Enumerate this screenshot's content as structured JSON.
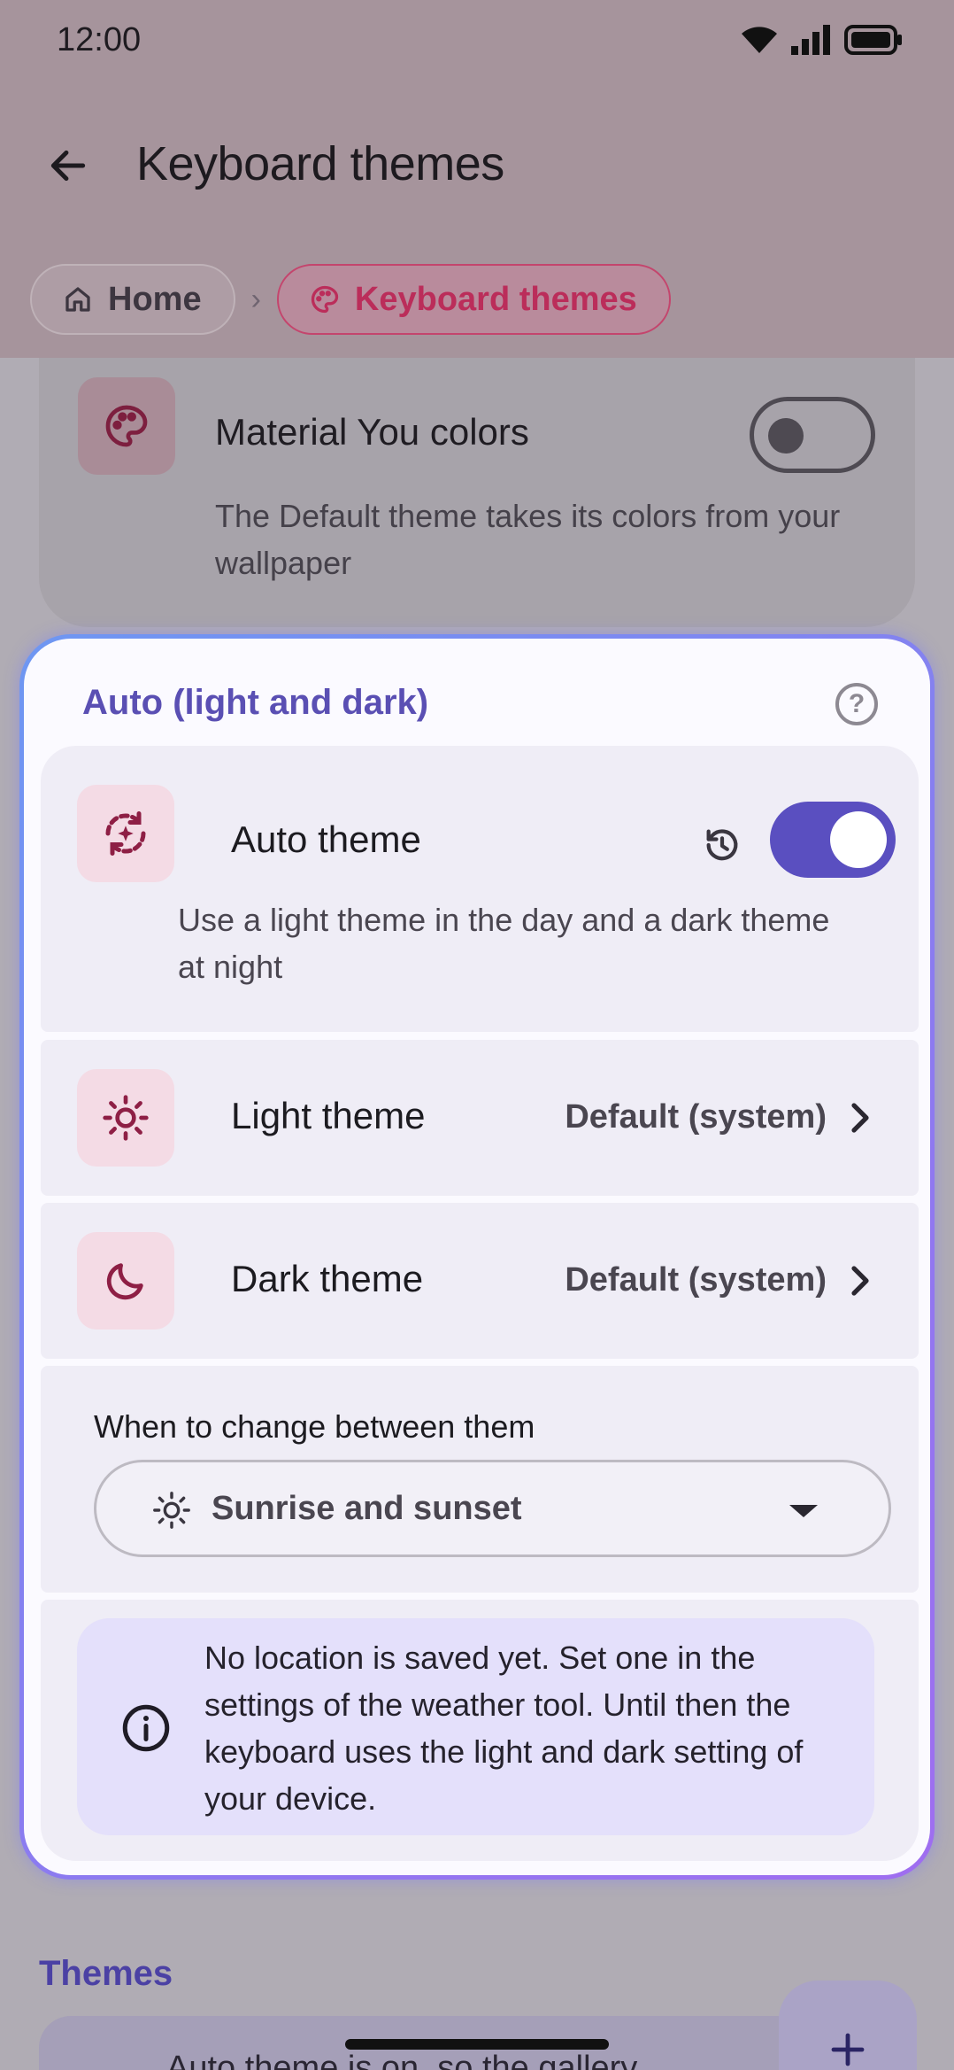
{
  "status_bar": {
    "time": "12:00"
  },
  "app_bar": {
    "title": "Keyboard themes"
  },
  "breadcrumb": {
    "home_label": "Home",
    "separator": "›",
    "current_label": "Keyboard themes"
  },
  "material_you": {
    "label": "Material You colors",
    "description": "The Default theme takes its colors from your wallpaper",
    "enabled": false
  },
  "auto_section": {
    "title": "Auto (light and dark)",
    "help": "?",
    "auto_theme": {
      "label": "Auto theme",
      "description": "Use a light theme in the day and a dark theme at night",
      "enabled": true
    },
    "light_theme": {
      "label": "Light theme",
      "value": "Default (system)"
    },
    "dark_theme": {
      "label": "Dark theme",
      "value": "Default (system)"
    },
    "when_to_change": {
      "label": "When to change between them",
      "selected": "Sunrise and sunset"
    },
    "info": "No location is saved yet. Set one in the settings of the weather tool. Until then the keyboard uses the light and dark setting of your device."
  },
  "themes": {
    "header": "Themes",
    "card_text": "Auto theme is on, so the gallery"
  },
  "fab": {
    "symbol": "+"
  },
  "colors": {
    "accent": "#5a4fc0",
    "brand_pink": "#bb2d5a",
    "highlight_gradient": [
      "#6e97f2",
      "#9f6ef0"
    ],
    "info_background": "#e4e0fb"
  }
}
